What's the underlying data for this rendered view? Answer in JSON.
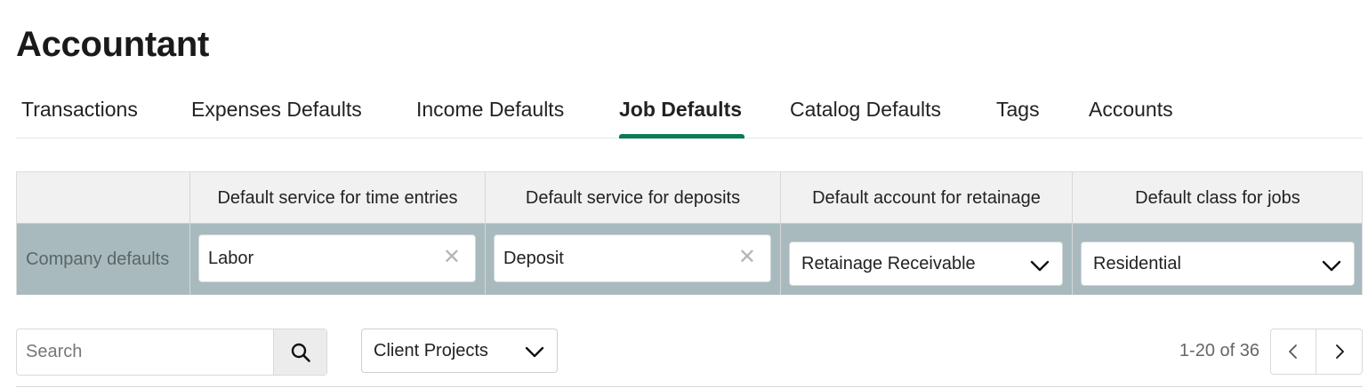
{
  "page": {
    "title": "Accountant"
  },
  "tabs": [
    {
      "label": "Transactions",
      "active": false
    },
    {
      "label": "Expenses Defaults",
      "active": false
    },
    {
      "label": "Income Defaults",
      "active": false
    },
    {
      "label": "Job Defaults",
      "active": true
    },
    {
      "label": "Catalog Defaults",
      "active": false
    },
    {
      "label": "Tags",
      "active": false
    },
    {
      "label": "Accounts",
      "active": false
    }
  ],
  "defaults_table": {
    "headers": [
      "",
      "Default service for time entries",
      "Default service for deposits",
      "Default account for retainage",
      "Default class for jobs"
    ],
    "row": {
      "label": "Company defaults",
      "time_service": {
        "value": "Labor",
        "clear_icon": "close-icon"
      },
      "deposit_service": {
        "value": "Deposit",
        "clear_icon": "close-icon"
      },
      "retainage_account": {
        "value": "Retainage Receivable",
        "icon": "chevron-down-icon"
      },
      "job_class": {
        "value": "Residential",
        "icon": "chevron-down-icon"
      }
    }
  },
  "toolbar": {
    "search_placeholder": "Search",
    "search_icon": "search-icon",
    "filter_value": "Client Projects",
    "pagination_text": "1-20 of 36",
    "prev_icon": "chevron-left-icon",
    "next_icon": "chevron-right-icon"
  },
  "colors": {
    "accent": "#0a7a57",
    "row_background": "#a8babd",
    "header_background": "#f1f1f1"
  }
}
